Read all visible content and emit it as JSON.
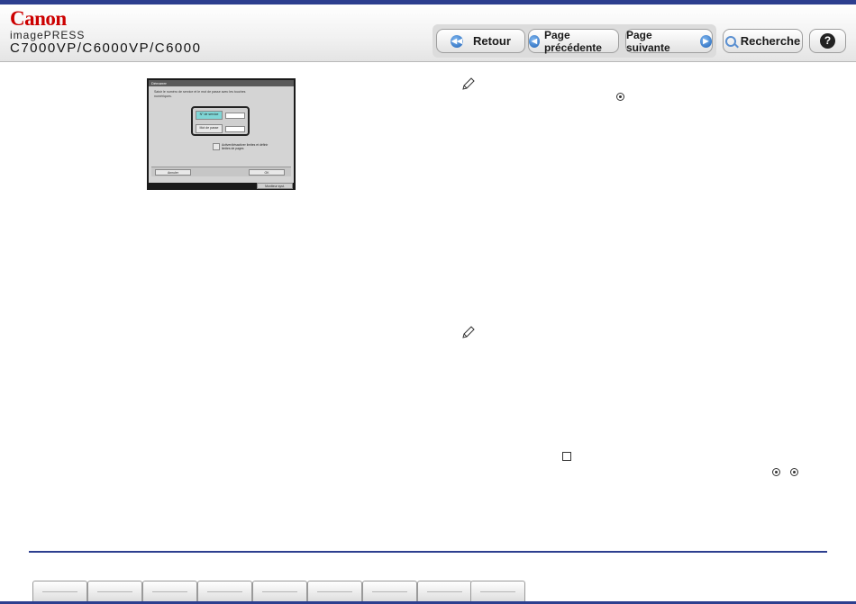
{
  "brand": {
    "logo": "Canon",
    "product": "imagePRESS",
    "models": "C7000VP/C6000VP/C6000"
  },
  "nav": {
    "back": "Retour",
    "prev": "Page précédente",
    "next": "Page suivante",
    "search": "Recherche",
    "help": "?"
  },
  "screenshot": {
    "title": "Démarrer",
    "message": "Saisir le numéro de service et le mot de passe avec les touches numériques.",
    "service_label": "N° de service",
    "password_label": "Mot de passe",
    "limits_label": "Activer/désactiver limites et définir limites de pages",
    "cancel": "Annuler",
    "ok": "OK",
    "status": "Moniteur syst."
  },
  "colors": {
    "accent": "#2d3f8f",
    "brand": "#cc0000",
    "nav_icon": "#1f63b8"
  },
  "icons": [
    "pencil-icon",
    "circle-key-icon",
    "square-key-icon"
  ],
  "footer_tab_count": 9
}
